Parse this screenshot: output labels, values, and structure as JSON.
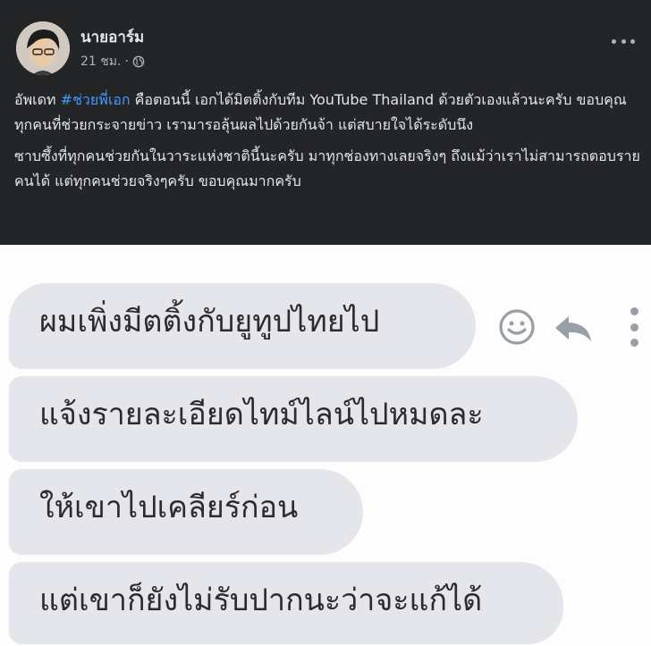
{
  "post": {
    "author": "นายอาร์ม",
    "time": "21 ชม.",
    "separator": "·",
    "paragraph1_before": "อัพเดท ",
    "hashtag": "#ช่วยพี่เอก",
    "paragraph1_after": " คือตอนนี้ เอกได้มิตติ้งกับทีม YouTube Thailand ด้วยตัวเองแล้วนะครับ ขอบคุณทุกคนที่ช่วยกระจายข่าว เรามารอลุ้นผลไปด้วยกันจ้า แต่สบายใจได้ระดับนึง",
    "paragraph2": "ซาบซึ้งที่ทุกคนช่วยกันในวาระแห่งชาตินี้นะครับ มาทุกช่องทางเลยจริงๆ ถึงแม้ว่าเราไม่สามารถตอบรายคนได้ แต่ทุกคนช่วยจริงๆครับ ขอบคุณมากครับ",
    "icons": {
      "privacy": "globe-icon",
      "menu": "more-options-icon"
    }
  },
  "chat": {
    "messages": [
      "ผมเพิ่งมีตติ้งกับยูทูปไทยไป",
      "แจ้งรายละเอียดไทม์ไลน์ไปหมดละ",
      "ให้เขาไปเคลียร์ก่อน",
      "แต่เขาก็ยังไม่รับปากนะว่าจะแก้ได้"
    ],
    "icons": {
      "react": "smiley-icon",
      "reply": "reply-icon",
      "more": "vertical-dots-icon"
    }
  },
  "colors": {
    "post_bg": "#242526",
    "hashtag": "#4599ff",
    "bubble_bg": "#e4e6eb"
  }
}
